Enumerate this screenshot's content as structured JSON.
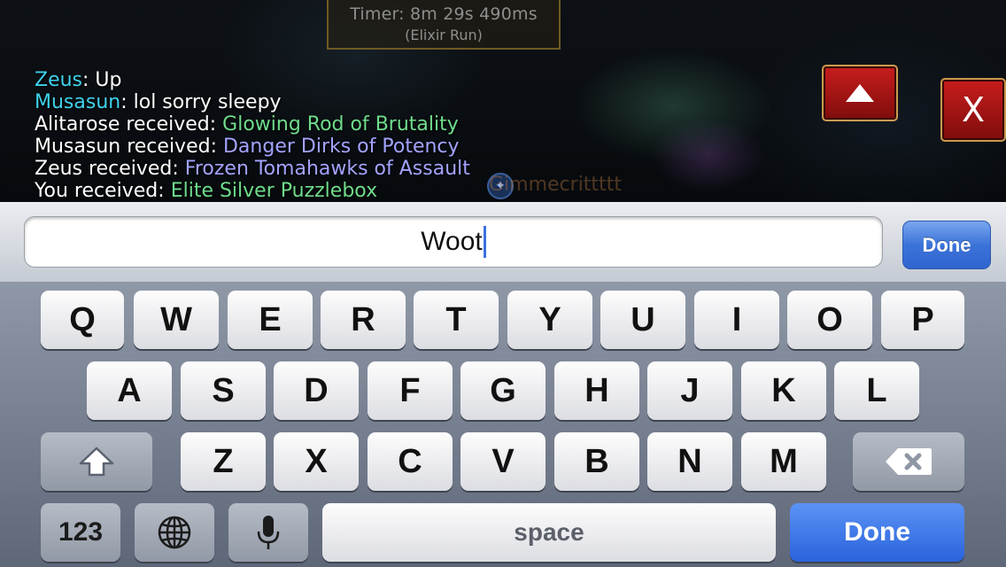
{
  "game": {
    "timer": "Timer: 8m 29s 490ms",
    "run_type": "(Elixir Run)",
    "player_name": "Gimmecrittttt",
    "chat": [
      {
        "name": "Zeus",
        "sep": ": ",
        "text": "Up"
      },
      {
        "name": "Musasun",
        "sep": ": ",
        "text": "lol sorry sleepy"
      },
      {
        "name": "Alitarose received",
        "sep": ": ",
        "text": "Glowing Rod of Brutality"
      },
      {
        "name": "Musasun received",
        "sep": ": ",
        "text": "Danger Dirks of Potency"
      },
      {
        "name": "Zeus received",
        "sep": ": ",
        "text": "Frozen Tomahawks of Assault"
      },
      {
        "name": "You received",
        "sep": ": ",
        "text": "Elite Silver Puzzlebox"
      }
    ],
    "up_icon": "triangle-up-icon",
    "close_label": "X",
    "colors": {
      "name_cyan": "#3fd2ec",
      "item_green": "#6fdc8c",
      "item_purple": "#a3a3ff",
      "button_red": "#c81d1d"
    }
  },
  "input": {
    "value": "Woot",
    "done_label": "Done"
  },
  "keyboard": {
    "row1": [
      "Q",
      "W",
      "E",
      "R",
      "T",
      "Y",
      "U",
      "I",
      "O",
      "P"
    ],
    "row2": [
      "A",
      "S",
      "D",
      "F",
      "G",
      "H",
      "J",
      "K",
      "L"
    ],
    "row3": [
      "Z",
      "X",
      "C",
      "V",
      "B",
      "N",
      "M"
    ],
    "shift_icon": "shift-arrow-icon",
    "backspace_icon": "backspace-icon",
    "numbers_label": "123",
    "globe_icon": "globe-icon",
    "mic_icon": "microphone-icon",
    "space_label": "space",
    "done_label": "Done"
  }
}
